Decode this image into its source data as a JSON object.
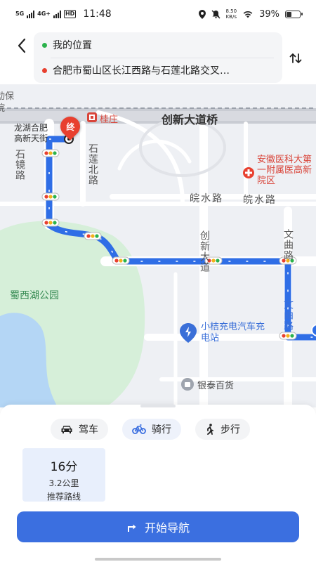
{
  "status_bar": {
    "net1": "5G",
    "net2": "4G+",
    "hd": "HD",
    "time": "11:48",
    "speed_value": "8.50",
    "speed_unit": "KB/s",
    "battery": "39%"
  },
  "route_input": {
    "start": "我的位置",
    "end": "合肥市蜀山区长江西路与石莲北路交叉…",
    "start_dot_color": "#2bb24c",
    "end_dot_color": "#e8402f"
  },
  "map": {
    "labels": {
      "dongbao_partial": "动保",
      "yuan_partial": "院",
      "guizhuang": "桂庄",
      "chuangxin_bridge": "创新大道桥",
      "longhu_hefei": "龙湖合肥",
      "gaoxin_tianjie": "高新天街",
      "shijing_road": "石镜路",
      "shilian_north_road": "石莲北路",
      "anyi_hospital": "安徽医科大第一附属医高新院区",
      "wanshui_road_1": "皖水路",
      "wanshui_road_2": "皖水路",
      "chuangxin_avenue": "创新大道",
      "wenqu_road_1": "文曲路",
      "wenqu_road_2": "文曲路",
      "shuxi_lake_park": "蜀西湖公园",
      "charging_station": "小桔充电汽车充电站",
      "yintai": "银泰百货",
      "end_marker": "终"
    },
    "colors": {
      "route": "#2f6ee6",
      "park": "#d6efd9",
      "water": "#b4d6f5",
      "road": "#ffffff",
      "major_road": "#c9ccd3"
    }
  },
  "panel": {
    "modes": [
      {
        "label": "驾车",
        "icon": "car-icon"
      },
      {
        "label": "骑行",
        "icon": "bicycle-icon"
      },
      {
        "label": "步行",
        "icon": "walk-icon"
      }
    ],
    "active_mode": "骑行",
    "route_option": {
      "time": "16分",
      "distance": "3.2公里",
      "tag": "推荐路线"
    },
    "start_nav": "开始导航",
    "accent": "#3b6fe0"
  }
}
